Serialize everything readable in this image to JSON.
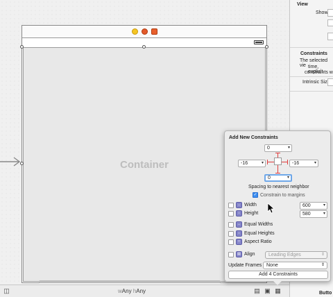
{
  "canvas": {
    "container_label": "Container",
    "size_class": {
      "w_prefix": "w",
      "w_value": "Any",
      "h_prefix": "h",
      "h_value": "Any"
    }
  },
  "inspector": {
    "view_title": "View",
    "show_label": "Show",
    "constraints_title": "Constraints",
    "constraints_text_1": "The selected vie",
    "constraints_text_2": "time, explicit",
    "constraints_text_3": "constraints w",
    "intrinsic_size_label": "Intrinsic Size",
    "button_label": "Butto"
  },
  "popover": {
    "title": "Add New Constraints",
    "top_value": "0",
    "left_value": "-16",
    "right_value": "-16",
    "bottom_value": "0",
    "spacing_label": "Spacing to nearest neighbor",
    "constrain_margins_label": "Constrain to margins",
    "width_label": "Width",
    "width_value": "600",
    "height_label": "Height",
    "height_value": "580",
    "equal_widths_label": "Equal Widths",
    "equal_heights_label": "Equal Heights",
    "aspect_ratio_label": "Aspect Ratio",
    "align_label": "Align",
    "align_value": "Leading Edges",
    "update_frames_label": "Update Frames",
    "update_frames_value": "None",
    "add_button_label": "Add 4 Constraints"
  },
  "colors": {
    "strut_red": "#e03c3c",
    "focus_blue": "#6ea7e8",
    "checkbox_blue": "#3d8ef0"
  },
  "icons": [
    "view-controller-icon",
    "first-responder-icon",
    "exit-icon",
    "battery-icon",
    "entry-point-arrow-icon",
    "document-outline-icon",
    "align-icon",
    "pin-icon",
    "resolve-issues-icon",
    "cursor-icon"
  ]
}
